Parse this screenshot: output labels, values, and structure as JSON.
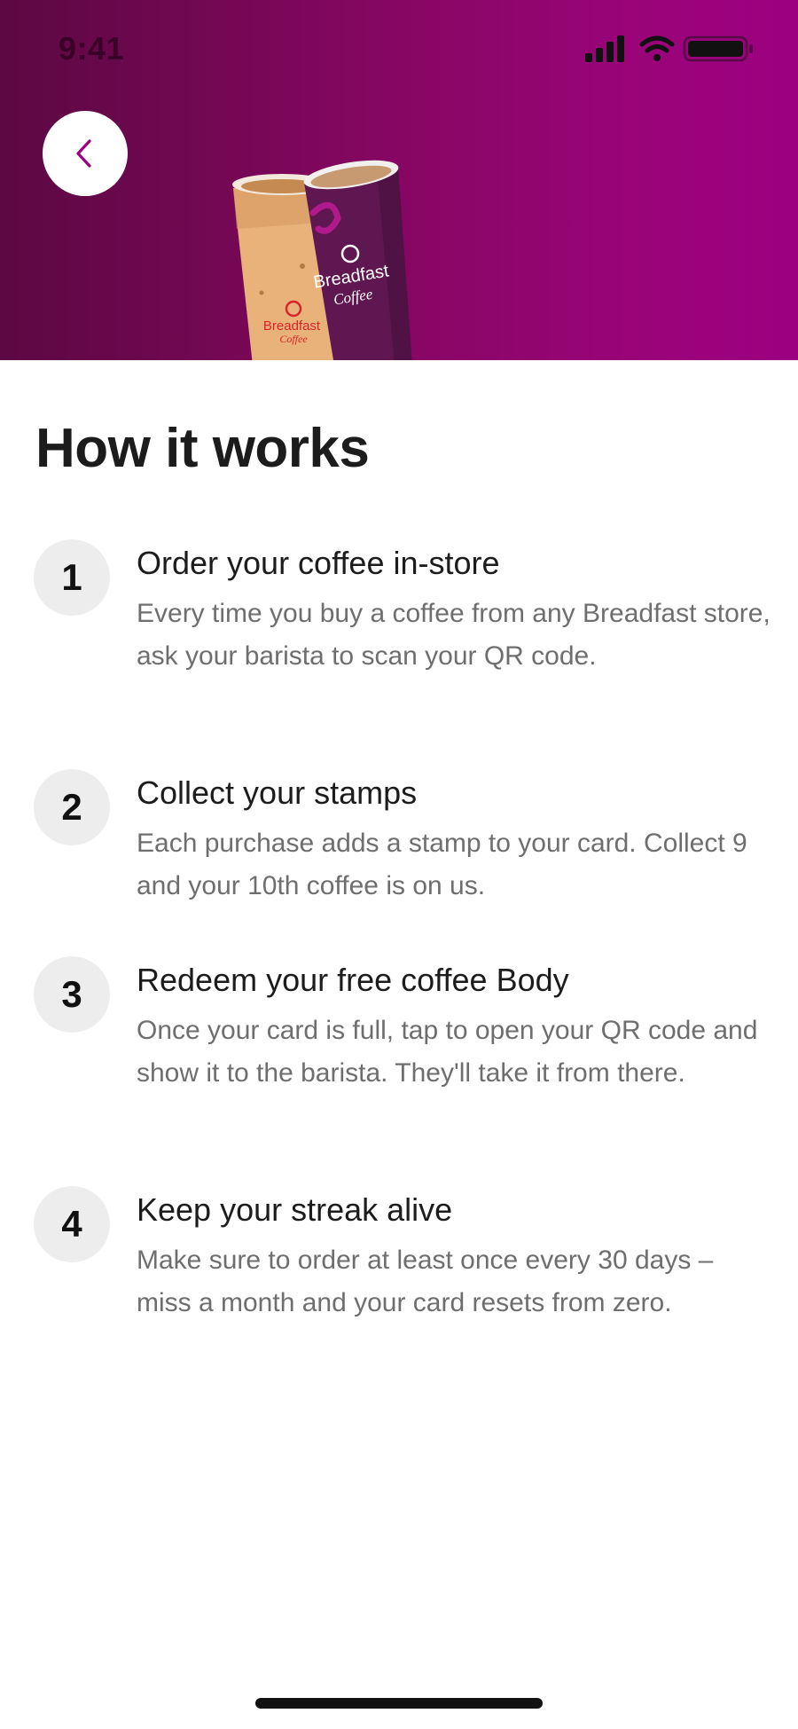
{
  "status_bar": {
    "time": "9:41",
    "icons": [
      "signal-icon",
      "wifi-icon",
      "battery-icon"
    ]
  },
  "header": {
    "back_icon": "chevron-left-icon",
    "gradient_colors": [
      "#5c0842",
      "#9c0080"
    ],
    "cup_left": {
      "brand": "Breadfast",
      "sub": "Coffee"
    },
    "cup_right": {
      "brand": "Breadfast",
      "sub": "Coffee"
    }
  },
  "page": {
    "title": "How it works"
  },
  "steps": [
    {
      "number": "1",
      "title": "Order your coffee in-store",
      "body": "Every time you buy a coffee from any Breadfast store, ask your barista to scan your QR code."
    },
    {
      "number": "2",
      "title": "Collect your stamps",
      "body": "Each purchase adds a stamp to your card. Collect 9 and your 10th coffee is on us."
    },
    {
      "number": "3",
      "title": "Redeem your free coffee Body",
      "body": "Once your card is full, tap to open your QR code and show it to the barista. They'll take it from there."
    },
    {
      "number": "4",
      "title": "Keep your streak alive",
      "body": "Make sure to order at least once every 30 days – miss a month and your card resets from zero."
    }
  ],
  "colors": {
    "accent": "#9c0080",
    "badge_bg": "#ededed",
    "body_text": "#6e6e6e"
  }
}
